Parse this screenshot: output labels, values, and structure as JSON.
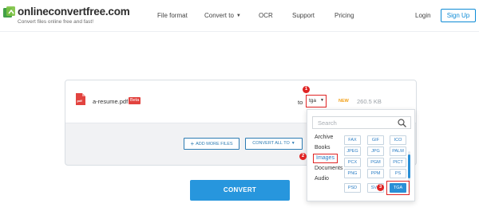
{
  "header": {
    "brand": "onlineconvertfree.com",
    "tagline": "Convert files online free and fast!",
    "nav": [
      {
        "label": "File format"
      },
      {
        "label": "Convert to"
      },
      {
        "label": "OCR"
      },
      {
        "label": "Support"
      },
      {
        "label": "Pricing"
      }
    ],
    "login_label": "Login",
    "signup_label": "Sign Up"
  },
  "file": {
    "name": "a-resume.pdf",
    "badge": "Beta",
    "to_label": "to",
    "selected_format": "tga",
    "new_tag": "NEW",
    "size": "260.5 KB"
  },
  "actions": {
    "add_more": "ADD MORE FILES",
    "convert_all": "CONVERT ALL TO",
    "convert": "CONVERT"
  },
  "markers": [
    "1",
    "2",
    "3"
  ],
  "dropdown": {
    "search_placeholder": "Search",
    "categories": [
      "Archive",
      "Books",
      "Images",
      "Documents",
      "Audio"
    ],
    "active_category": "Images",
    "formats": [
      [
        "FAX",
        "GIF",
        "ICO"
      ],
      [
        "JPEG",
        "JPG",
        "PALM"
      ],
      [
        "PCX",
        "PGM",
        "PICT"
      ],
      [
        "PNG",
        "PPM",
        "PS"
      ],
      [
        "PSD",
        "SVG",
        "TGA"
      ]
    ],
    "selected_format_tile": "TGA"
  },
  "colors": {
    "accent": "#2796dd",
    "highlight": "#e02424",
    "brand_green": "#43a047"
  }
}
